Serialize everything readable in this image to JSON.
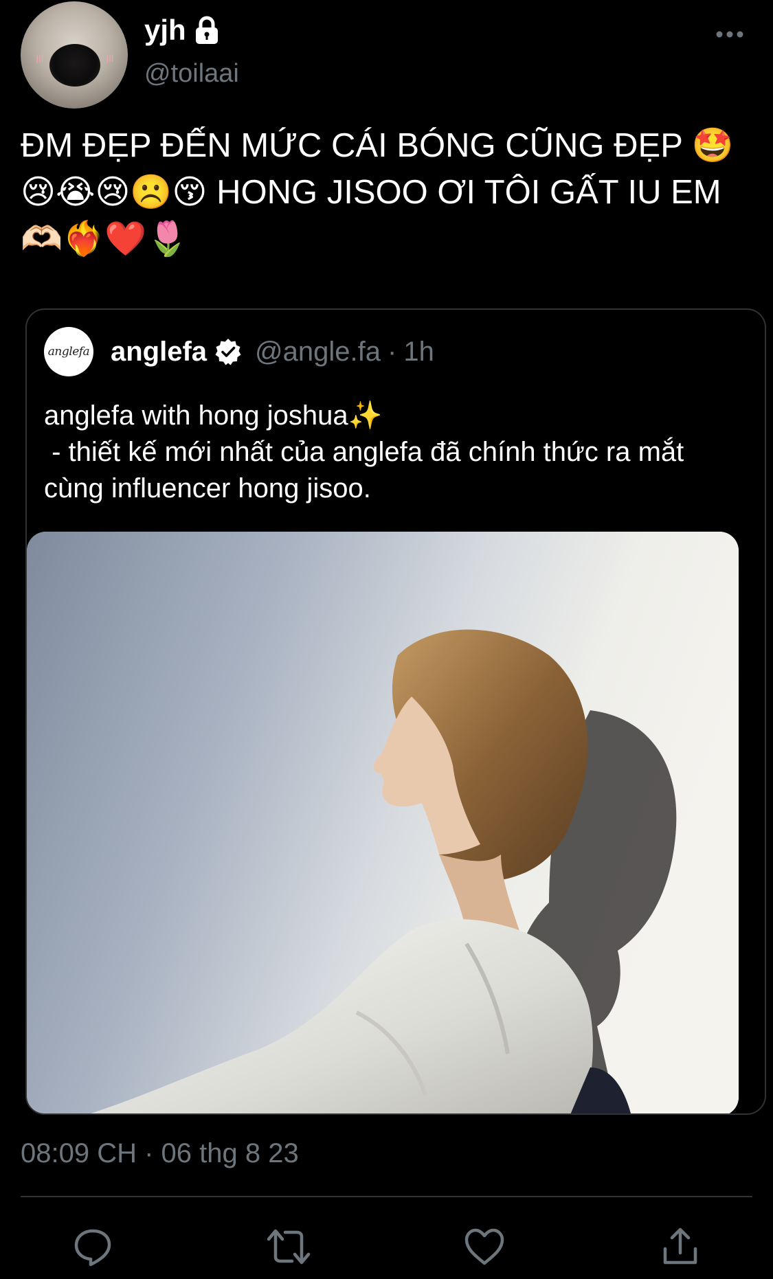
{
  "author": {
    "display_name": "yjh",
    "handle": "@toilaai",
    "avatar_icon": "seal-face-avatar",
    "protected_icon": "lock-icon"
  },
  "tweet": {
    "text": "ĐM ĐẸP ĐẾN MỨC CÁI BÓNG CŨNG ĐẸP 🤩😢😭😢☹️😚 HONG JISOO ƠI TÔI GẤT IU EM 🫶🏻❤️‍🔥❤️🌷",
    "timestamp": "08:09 CH · 06 thg 8 23"
  },
  "quoted_tweet": {
    "avatar_text": "anglefa",
    "display_name": "anglefa",
    "handle": "@angle.fa",
    "separator": "·",
    "time": "1h",
    "text": "anglefa with hong joshua✨\n - thiết kế mới nhất của anglefa đã chính thức ra mắt cùng influencer hong jisoo.",
    "media_description_icon": "photo-thumbnail"
  },
  "actions": {
    "reply_icon": "reply-icon",
    "retweet_icon": "retweet-icon",
    "like_icon": "heart-icon",
    "share_icon": "share-icon"
  },
  "colors": {
    "background": "#000000",
    "text_primary": "#ffffff",
    "text_secondary": "#6e767d",
    "border": "#2f3336"
  }
}
